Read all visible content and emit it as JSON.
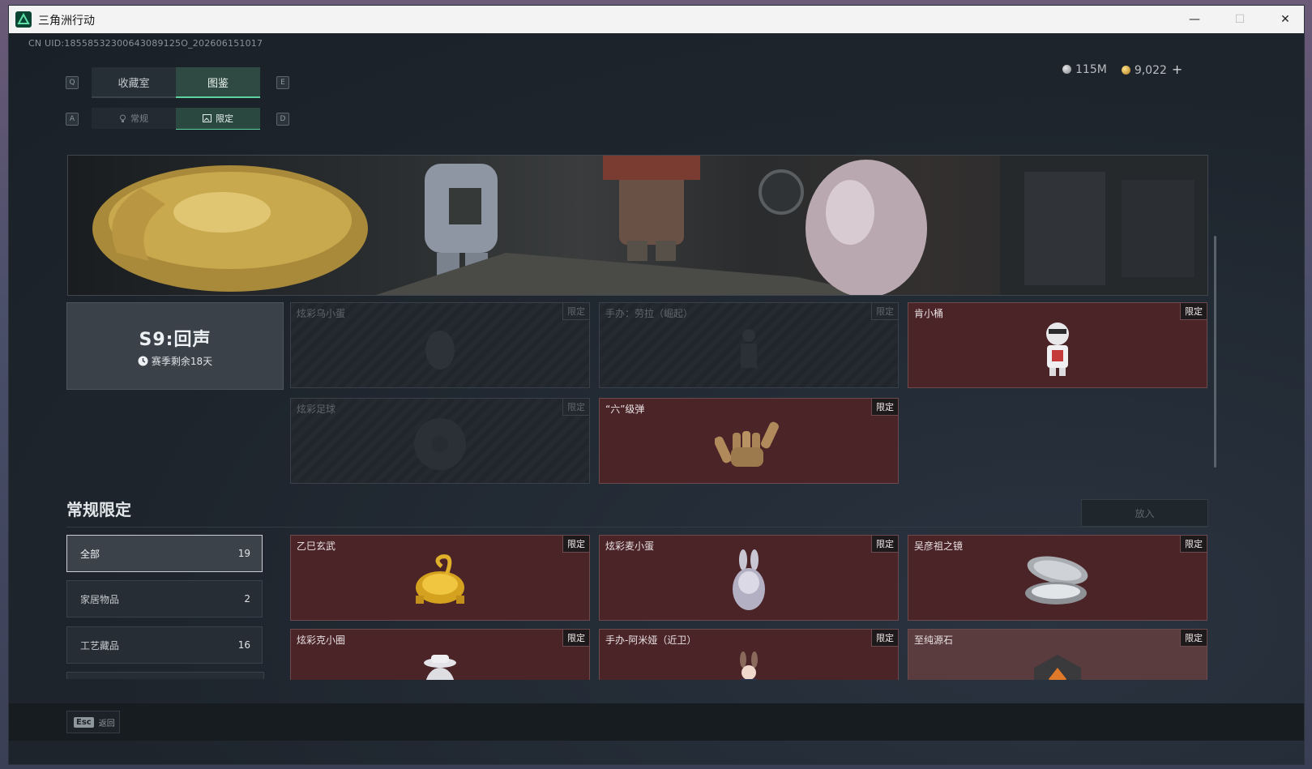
{
  "window": {
    "title": "三角洲行动",
    "minimize": "—",
    "maximize": "☐",
    "close": "✕"
  },
  "header": {
    "uid": "CN UID:18558532300643089125O_202606151017",
    "currency": [
      {
        "icon": "silver-coin-icon",
        "value": "115M"
      },
      {
        "icon": "gold-coin-icon",
        "value": "9,022"
      }
    ],
    "add_label": "+"
  },
  "tabs": {
    "main": [
      {
        "label": "收藏室",
        "active": false
      },
      {
        "label": "图鉴",
        "active": true
      }
    ],
    "sub": [
      {
        "label": "常规",
        "icon": "bulb-icon",
        "active": false
      },
      {
        "label": "限定",
        "icon": "image-icon",
        "active": true
      }
    ],
    "keys": {
      "prev_main": "Q",
      "next_main": "E",
      "prev_sub": "A",
      "next_sub": "D"
    }
  },
  "season": {
    "title": "S9:回声",
    "remaining": "赛季剩余18天"
  },
  "season_items": [
    {
      "name": "炫彩乌小蛋",
      "badge": "限定",
      "owned": false
    },
    {
      "name": "手办：劳拉（崛起）",
      "badge": "限定",
      "owned": false
    },
    {
      "name": "肯小桶",
      "badge": "限定",
      "owned": true
    },
    {
      "name": "炫彩足球",
      "badge": "限定",
      "owned": false
    },
    {
      "name": "“六”级弹",
      "badge": "限定",
      "owned": true
    }
  ],
  "section": {
    "title": "常规限定",
    "place_button": "放入"
  },
  "filters": [
    {
      "label": "全部",
      "count": "19",
      "active": true
    },
    {
      "label": "家居物品",
      "count": "2",
      "active": false
    },
    {
      "label": "工艺藏品",
      "count": "16",
      "active": false
    }
  ],
  "regular_items": [
    {
      "name": "乙巳玄武",
      "badge": "限定"
    },
    {
      "name": "炫彩麦小蛋",
      "badge": "限定"
    },
    {
      "name": "吴彦祖之镜",
      "badge": "限定"
    },
    {
      "name": "炫彩克小圈",
      "badge": "限定"
    },
    {
      "name": "手办-阿米娅（近卫）",
      "badge": "限定"
    },
    {
      "name": "至纯源石",
      "badge": "限定"
    }
  ],
  "footer": {
    "esc_key": "Esc",
    "back_label": "返回"
  }
}
